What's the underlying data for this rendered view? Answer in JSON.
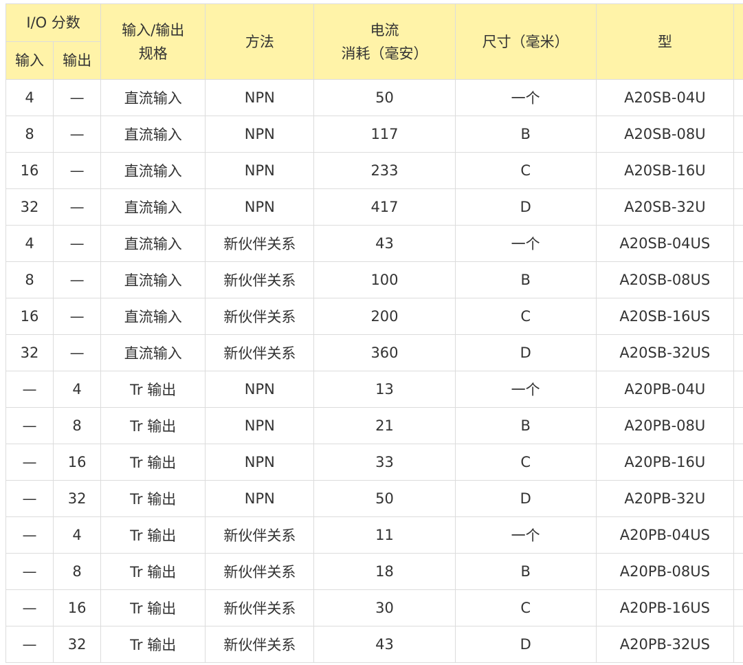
{
  "header": {
    "io_points": "I/O 分数",
    "input": "输入",
    "output": "输出",
    "spec_line1": "输入/输出",
    "spec_line2": "规格",
    "method": "方法",
    "current_line1": "电流",
    "current_line2": "消耗（毫安）",
    "size": "尺寸（毫米）",
    "model": "型"
  },
  "rows": [
    [
      "4",
      "—",
      "直流输入",
      "NPN",
      "50",
      "一个",
      "A20SB-04U"
    ],
    [
      "8",
      "—",
      "直流输入",
      "NPN",
      "117",
      "B",
      "A20SB-08U"
    ],
    [
      "16",
      "—",
      "直流输入",
      "NPN",
      "233",
      "C",
      "A20SB-16U"
    ],
    [
      "32",
      "—",
      "直流输入",
      "NPN",
      "417",
      "D",
      "A20SB-32U"
    ],
    [
      "4",
      "—",
      "直流输入",
      "新伙伴关系",
      "43",
      "一个",
      "A20SB-04US"
    ],
    [
      "8",
      "—",
      "直流输入",
      "新伙伴关系",
      "100",
      "B",
      "A20SB-08US"
    ],
    [
      "16",
      "—",
      "直流输入",
      "新伙伴关系",
      "200",
      "C",
      "A20SB-16US"
    ],
    [
      "32",
      "—",
      "直流输入",
      "新伙伴关系",
      "360",
      "D",
      "A20SB-32US"
    ],
    [
      "—",
      "4",
      "Tr 输出",
      "NPN",
      "13",
      "一个",
      "A20PB-04U"
    ],
    [
      "—",
      "8",
      "Tr 输出",
      "NPN",
      "21",
      "B",
      "A20PB-08U"
    ],
    [
      "—",
      "16",
      "Tr 输出",
      "NPN",
      "33",
      "C",
      "A20PB-16U"
    ],
    [
      "—",
      "32",
      "Tr 输出",
      "NPN",
      "50",
      "D",
      "A20PB-32U"
    ],
    [
      "—",
      "4",
      "Tr 输出",
      "新伙伴关系",
      "11",
      "一个",
      "A20PB-04US"
    ],
    [
      "—",
      "8",
      "Tr 输出",
      "新伙伴关系",
      "18",
      "B",
      "A20PB-08US"
    ],
    [
      "—",
      "16",
      "Tr 输出",
      "新伙伴关系",
      "30",
      "C",
      "A20PB-16US"
    ],
    [
      "—",
      "32",
      "Tr 输出",
      "新伙伴关系",
      "43",
      "D",
      "A20PB-32US"
    ]
  ]
}
